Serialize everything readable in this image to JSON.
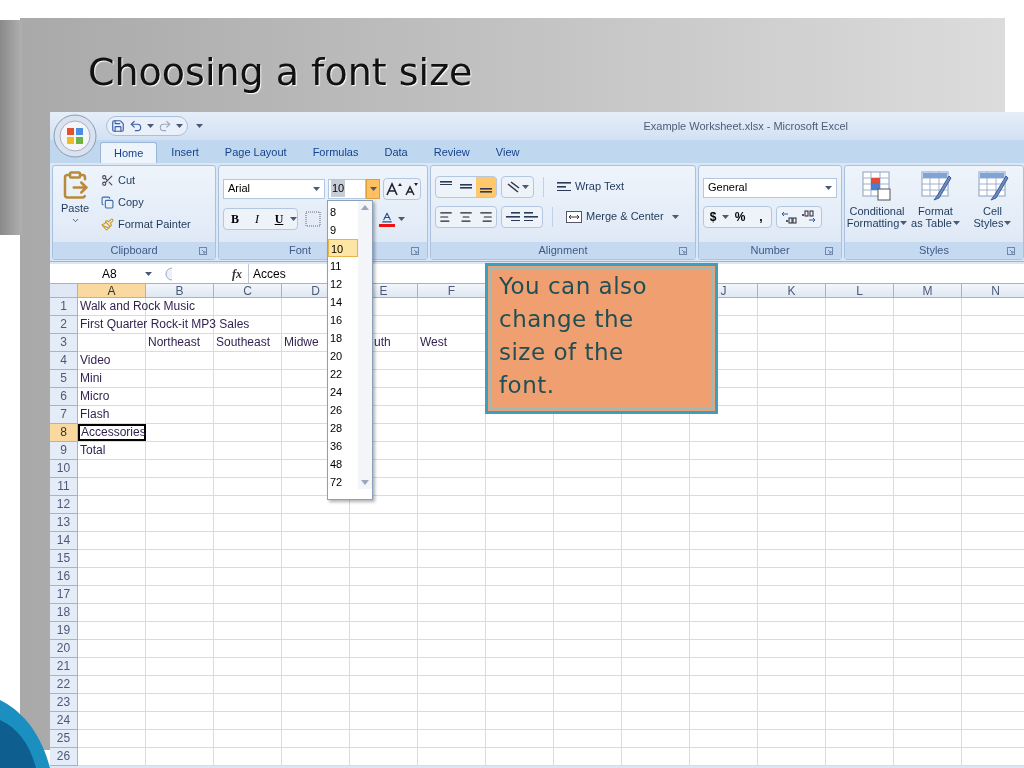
{
  "slide": {
    "title": "Choosing a font size"
  },
  "window": {
    "title": "Example Worksheet.xlsx - Microsoft Excel"
  },
  "tabs": [
    {
      "label": "Home",
      "selected": true
    },
    {
      "label": "Insert",
      "selected": false
    },
    {
      "label": "Page Layout",
      "selected": false
    },
    {
      "label": "Formulas",
      "selected": false
    },
    {
      "label": "Data",
      "selected": false
    },
    {
      "label": "Review",
      "selected": false
    },
    {
      "label": "View",
      "selected": false
    }
  ],
  "clipboard": {
    "paste": "Paste",
    "cut": "Cut",
    "copy": "Copy",
    "format_painter": "Format Painter",
    "label": "Clipboard"
  },
  "font": {
    "name": "Arial",
    "size": "10",
    "bold": "B",
    "italic": "I",
    "underline": "U",
    "label": "Font"
  },
  "font_size_list": [
    {
      "label": "8",
      "selected": false
    },
    {
      "label": "9",
      "selected": false
    },
    {
      "label": "10",
      "selected": true
    },
    {
      "label": "11",
      "selected": false
    },
    {
      "label": "12",
      "selected": false
    },
    {
      "label": "14",
      "selected": false
    },
    {
      "label": "16",
      "selected": false
    },
    {
      "label": "18",
      "selected": false
    },
    {
      "label": "20",
      "selected": false
    },
    {
      "label": "22",
      "selected": false
    },
    {
      "label": "24",
      "selected": false
    },
    {
      "label": "26",
      "selected": false
    },
    {
      "label": "28",
      "selected": false
    },
    {
      "label": "36",
      "selected": false
    },
    {
      "label": "48",
      "selected": false
    },
    {
      "label": "72",
      "selected": false
    }
  ],
  "alignment": {
    "wrap_text": "Wrap Text",
    "merge": "Merge & Center",
    "label": "Alignment"
  },
  "number": {
    "format": "General",
    "currency": "$",
    "percent": "%",
    "comma": ",",
    "label": "Number"
  },
  "styles": {
    "items": [
      {
        "line1": "Conditional",
        "line2": "Formatting"
      },
      {
        "line1": "Format",
        "line2": "as Table"
      },
      {
        "line1": "Cell",
        "line2": "Styles"
      }
    ],
    "label": "Styles"
  },
  "formula_bar": {
    "name_box": "A8",
    "function_label": "fx",
    "content": "Acces"
  },
  "columns_left": [
    {
      "label": "A",
      "selected": true
    },
    {
      "label": "B",
      "selected": false
    },
    {
      "label": "C",
      "selected": false
    },
    {
      "label": "D",
      "selected": false
    },
    {
      "label": "E",
      "selected": false
    },
    {
      "label": "F",
      "selected": false
    }
  ],
  "columns_right": [
    {
      "label": "J",
      "selected": false
    },
    {
      "label": "K",
      "selected": false
    },
    {
      "label": "L",
      "selected": false
    },
    {
      "label": "M",
      "selected": false
    },
    {
      "label": "N",
      "selected": false
    }
  ],
  "rows": [
    {
      "number": "1",
      "selected": false,
      "cells": {
        "column_a": "Walk and Rock Music"
      }
    },
    {
      "number": "2",
      "selected": false,
      "cells": {
        "column_a": "First Quarter Rock-it MP3 Sales"
      }
    },
    {
      "number": "3",
      "selected": false,
      "cells": {
        "column_b": "Northeast",
        "column_c": "Southeast",
        "column_d": "Midwe",
        "column_e": "uth",
        "column_f": "West"
      }
    },
    {
      "number": "4",
      "selected": false,
      "cells": {
        "column_a": "Video"
      }
    },
    {
      "number": "5",
      "selected": false,
      "cells": {
        "column_a": "Mini"
      }
    },
    {
      "number": "6",
      "selected": false,
      "cells": {
        "column_a": "Micro"
      }
    },
    {
      "number": "7",
      "selected": false,
      "cells": {
        "column_a": "Flash"
      }
    },
    {
      "number": "8",
      "selected": true,
      "cells": {
        "column_a": "Accessories"
      }
    },
    {
      "number": "9",
      "selected": false,
      "cells": {
        "column_a": "Total"
      }
    },
    {
      "number": "10",
      "selected": false,
      "cells": {}
    },
    {
      "number": "11",
      "selected": false,
      "cells": {}
    },
    {
      "number": "12",
      "selected": false,
      "cells": {}
    },
    {
      "number": "13",
      "selected": false,
      "cells": {}
    },
    {
      "number": "14",
      "selected": false,
      "cells": {}
    },
    {
      "number": "15",
      "selected": false,
      "cells": {}
    },
    {
      "number": "16",
      "selected": false,
      "cells": {}
    },
    {
      "number": "17",
      "selected": false,
      "cells": {}
    },
    {
      "number": "18",
      "selected": false,
      "cells": {}
    },
    {
      "number": "19",
      "selected": false,
      "cells": {}
    },
    {
      "number": "20",
      "selected": false,
      "cells": {}
    },
    {
      "number": "21",
      "selected": false,
      "cells": {}
    },
    {
      "number": "22",
      "selected": false,
      "cells": {}
    },
    {
      "number": "23",
      "selected": false,
      "cells": {}
    },
    {
      "number": "24",
      "selected": false,
      "cells": {}
    },
    {
      "number": "25",
      "selected": false,
      "cells": {}
    },
    {
      "number": "26",
      "selected": false,
      "cells": {}
    }
  ],
  "callout": {
    "text": "You can also change the size of the font."
  }
}
